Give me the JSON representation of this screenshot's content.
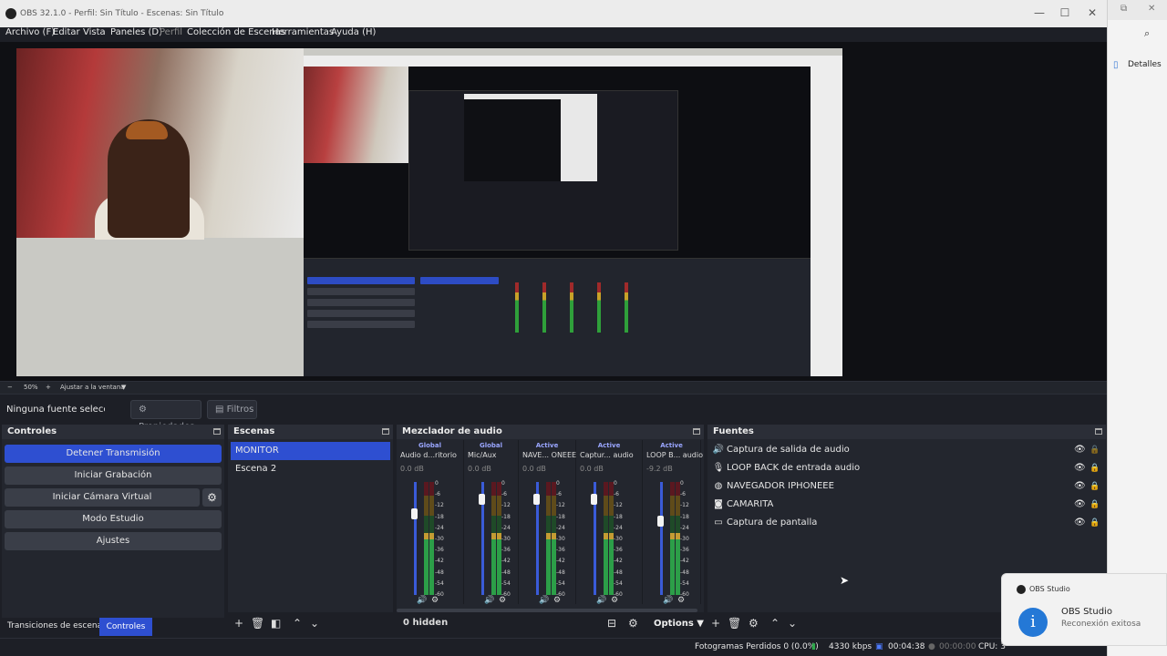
{
  "window": {
    "title": "OBS 32.1.0 - Perfil: Sin Título - Escenas: Sin Título",
    "minimize": "—",
    "maximize": "☐",
    "close": "✕"
  },
  "menu": {
    "items": [
      "Archivo (F)",
      "Editar",
      "Vista",
      "Paneles (D)",
      "Perfil",
      "Colección de Escenas",
      "Herramientas",
      "Ayuda (H)"
    ]
  },
  "zoom": {
    "minus": "−",
    "level": "50%",
    "plus": "+",
    "fit": "Ajustar a la ventana"
  },
  "source_bar": {
    "no_source": "Ninguna fuente seleccionada",
    "properties": "Propiedades",
    "filters": "Filtros"
  },
  "controls": {
    "title": "Controles",
    "buttons": [
      "Detener Transmisión",
      "Iniciar Grabación",
      "Iniciar Cámara Virtual",
      "Modo Estudio",
      "Ajustes"
    ],
    "tab_transitions": "Transiciones de escena",
    "tab_controls": "Controles"
  },
  "scenes": {
    "title": "Escenas",
    "items": [
      "MONITOR",
      "Escena 2"
    ]
  },
  "mixer": {
    "title": "Mezclador de audio",
    "strips": [
      {
        "badge": "Global",
        "name": "Audio d...ritorio",
        "db": "0.0 dB",
        "level": 0.72
      },
      {
        "badge": "Global",
        "name": "Mic/Aux",
        "db": "0.0 dB",
        "level": 0.85
      },
      {
        "badge": "Active",
        "name": "NAVE... ONEEE",
        "db": "0.0 dB",
        "level": 0.85
      },
      {
        "badge": "Active",
        "name": "Captur... audio",
        "db": "0.0 dB",
        "level": 0.85
      },
      {
        "badge": "Active",
        "name": "LOOP B... audio",
        "db": "-9.2 dB",
        "level": 0.65
      }
    ],
    "ticks": [
      "0",
      "-6",
      "-12",
      "-18",
      "-24",
      "-30",
      "-36",
      "-42",
      "-48",
      "-54",
      "-60"
    ],
    "hidden": "0 hidden",
    "options": "Options"
  },
  "sources": {
    "title": "Fuentes",
    "items": [
      {
        "icon": "speaker-icon",
        "label": "Captura de salida de audio"
      },
      {
        "icon": "microphone-icon",
        "label": "LOOP BACK de entrada audio"
      },
      {
        "icon": "globe-icon",
        "label": "NAVEGADOR IPHONEEE"
      },
      {
        "icon": "camera-icon",
        "label": "CAMARITA"
      },
      {
        "icon": "monitor-icon",
        "label": "Captura de pantalla"
      }
    ]
  },
  "status": {
    "dropped": "Fotogramas Perdidos 0 (0.0%)",
    "kbps": "4330 kbps",
    "stream_time": "00:04:38",
    "rec_time": "00:00:00",
    "cpu": "CPU: 3"
  },
  "side_window": {
    "details": "Detalles"
  },
  "toast": {
    "app": "OBS Studio",
    "title": "OBS Studio",
    "message": "Reconexión exitosa"
  }
}
